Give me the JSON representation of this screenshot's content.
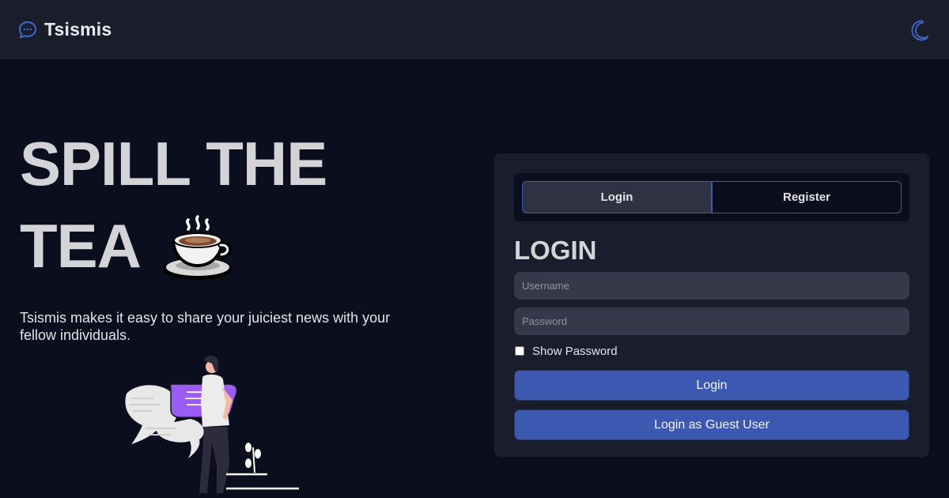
{
  "app": {
    "name": "Tsismis"
  },
  "hero": {
    "title_line1": "SPILL THE",
    "title_line2": "TEA",
    "description": "Tsismis makes it easy to share your juiciest news with your fellow individuals."
  },
  "auth": {
    "tabs": [
      {
        "label": "Login",
        "active": true
      },
      {
        "label": "Register",
        "active": false
      }
    ],
    "form_title": "LOGIN",
    "username_placeholder": "Username",
    "password_placeholder": "Password",
    "show_password_label": "Show Password",
    "show_password_checked": false,
    "login_button": "Login",
    "guest_button": "Login as Guest User"
  },
  "icons": {
    "brand": "chat-bubble-icon",
    "theme_toggle": "moon-icon",
    "hero": "coffee-cup-icon"
  },
  "colors": {
    "background": "#0b0e1c",
    "navbar": "#1a1d2b",
    "accent": "#3d58b0",
    "input": "#363949",
    "speech_bubble": "#9b5cf6"
  }
}
